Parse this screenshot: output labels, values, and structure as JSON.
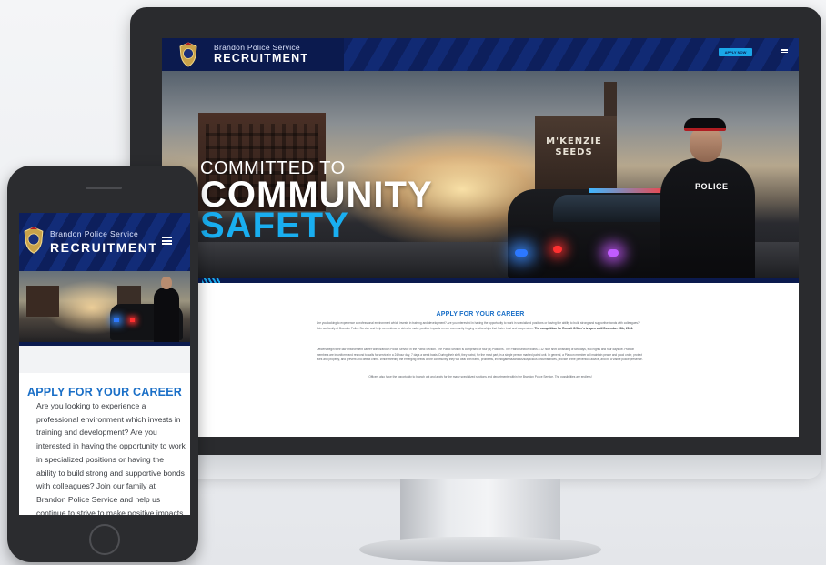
{
  "desktop": {
    "header": {
      "brand_top": "Brandon Police Service",
      "brand_main": "RECRUITMENT",
      "apply_button": "APPLY NOW"
    },
    "hero": {
      "line1": "COMMITTED TO",
      "line2": "COMMUNITY",
      "line3": "SAFETY",
      "building_sign": "M'KENZIE SEEDS",
      "vest_label": "POLICE"
    },
    "content": {
      "title": "APPLY FOR YOUR CAREER",
      "p1": "Are you looking to experience a professional environment which invests in training and development? Are you interested in having the opportunity to work in specialized positions or having the ability to build strong and supportive bonds with colleagues? Join our family at Brandon Police Service and help us continue to strive to make positive impacts on our community forging relationships that foster trust and cooperation.",
      "p1_bold": "The competition for Recruit Officer's is open until December 20th, 2024.",
      "p2": "Officers begin their law enforcement career with Brandon Police Service in the Patrol Section. The Patrol Section is comprised of four (4) Platoons. The Patrol Section works a 12 hour shift consisting of two days, two nights and four days off. Platoon members are in uniform and respond to calls for service in a 24 hour day, 7 days a week basis. During their shift, they patrol, for the most part, in a single person marked patrol unit. In general, a Platoon member will maintain peace and good order, protect lives and property, and prevent and detect crime. While meeting the emerging needs of the community, they will deal with traffic, problems, investigate hazardous/suspicious circumstances, provide crime prevention advice, and be a visible police presence.",
      "p3": "Officers also have the opportunity to branch out and apply for the many specialized sections and departments within the Brandon Police Service. The possibilities are endless!"
    }
  },
  "phone": {
    "header": {
      "brand_top": "Brandon Police Service",
      "brand_main": "RECRUITMENT"
    },
    "content": {
      "title": "APPLY FOR YOUR CAREER",
      "text": "Are you looking to experience a professional environment which invests in training and development? Are you interested in having the opportunity to work in specialized positions or having the ability to build strong and supportive bonds with colleagues? Join our family at Brandon Police Service and help us continue to strive to make positive impacts"
    }
  },
  "icons": {
    "badge": "police-badge-icon",
    "menu": "hamburger-menu-icon"
  },
  "colors": {
    "header_navy": "#0d1f5c",
    "accent_blue": "#19aef0",
    "title_blue": "#1a6fc7"
  }
}
